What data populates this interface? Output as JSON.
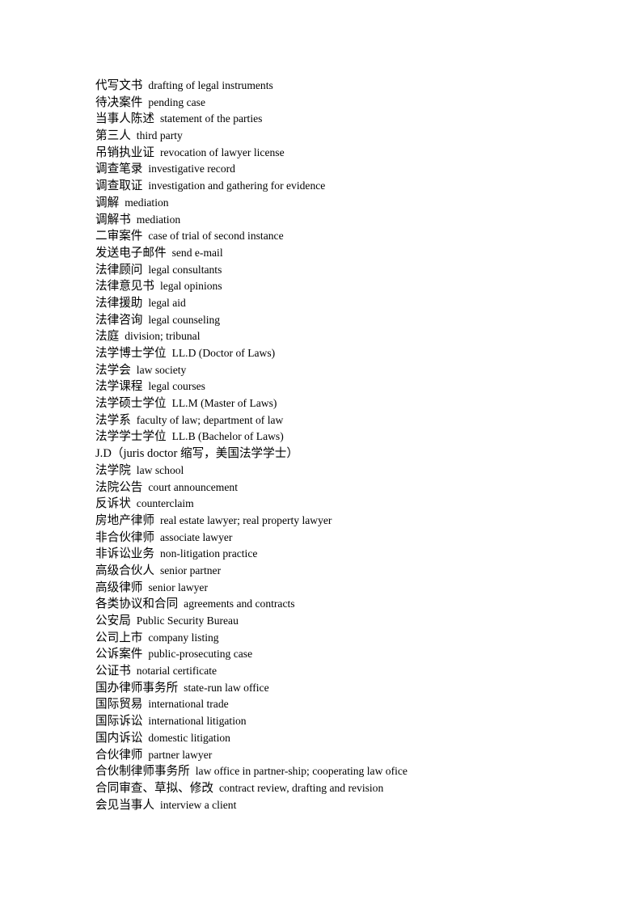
{
  "document": {
    "type": "glossary",
    "background_color": "#ffffff",
    "text_color": "#000000",
    "entries": [
      {
        "term": "代写文书",
        "gloss": "drafting of legal instruments"
      },
      {
        "term": "待决案件",
        "gloss": "pending case"
      },
      {
        "term": "当事人陈述",
        "gloss": "statement of the parties"
      },
      {
        "term": "第三人",
        "gloss": "third party"
      },
      {
        "term": "吊销执业证",
        "gloss": "revocation of lawyer license"
      },
      {
        "term": "调查笔录",
        "gloss": "investigative record"
      },
      {
        "term": "调查取证",
        "gloss": "investigation and gathering for evidence"
      },
      {
        "term": "调解",
        "gloss": "mediation"
      },
      {
        "term": "调解书",
        "gloss": "mediation"
      },
      {
        "term": "二审案件",
        "gloss": "case of trial of second instance"
      },
      {
        "term": "发送电子邮件",
        "gloss": "send e-mail"
      },
      {
        "term": "法律顾问",
        "gloss": "legal consultants"
      },
      {
        "term": "法律意见书",
        "gloss": "legal opinions"
      },
      {
        "term": "法律援助",
        "gloss": "legal aid"
      },
      {
        "term": "法律咨询",
        "gloss": "legal counseling"
      },
      {
        "term": "法庭",
        "gloss": "division; tribunal"
      },
      {
        "term": "法学博士学位",
        "gloss": "LL.D (Doctor of Laws)"
      },
      {
        "term": "法学会",
        "gloss": "law society"
      },
      {
        "term": "法学课程",
        "gloss": "legal courses"
      },
      {
        "term": "法学硕士学位",
        "gloss": "LL.M (Master of Laws)"
      },
      {
        "term": "法学系",
        "gloss": "faculty of law; department of law"
      },
      {
        "term": "法学学士学位",
        "gloss": "LL.B (Bachelor of Laws)"
      },
      {
        "term": "J.D（juris doctor 缩写，美国法学学士）",
        "gloss": ""
      },
      {
        "term": "法学院",
        "gloss": "law school"
      },
      {
        "term": "法院公告",
        "gloss": "court announcement"
      },
      {
        "term": "反诉状",
        "gloss": "counterclaim"
      },
      {
        "term": "房地产律师",
        "gloss": "real estate lawyer; real property lawyer"
      },
      {
        "term": "非合伙律师",
        "gloss": "associate lawyer"
      },
      {
        "term": "非诉讼业务",
        "gloss": "non-litigation practice"
      },
      {
        "term": "高级合伙人",
        "gloss": "senior partner"
      },
      {
        "term": "高级律师",
        "gloss": "senior lawyer"
      },
      {
        "term": "各类协议和合同",
        "gloss": "agreements and contracts"
      },
      {
        "term": "公安局",
        "gloss": "Public Security Bureau"
      },
      {
        "term": "公司上市",
        "gloss": "company listing"
      },
      {
        "term": "公诉案件",
        "gloss": "public-prosecuting case"
      },
      {
        "term": "公证书",
        "gloss": "notarial certificate"
      },
      {
        "term": "国办律师事务所",
        "gloss": "state-run law office"
      },
      {
        "term": "国际贸易",
        "gloss": "international trade"
      },
      {
        "term": "国际诉讼",
        "gloss": "international litigation"
      },
      {
        "term": "国内诉讼",
        "gloss": "domestic litigation"
      },
      {
        "term": "合伙律师",
        "gloss": "partner lawyer"
      },
      {
        "term": "合伙制律师事务所",
        "gloss": "law office in partner-ship; cooperating law ofice"
      },
      {
        "term": "合同审查、草拟、修改",
        "gloss": "contract review, drafting and revision"
      },
      {
        "term": "会见当事人",
        "gloss": "interview a client"
      }
    ]
  }
}
